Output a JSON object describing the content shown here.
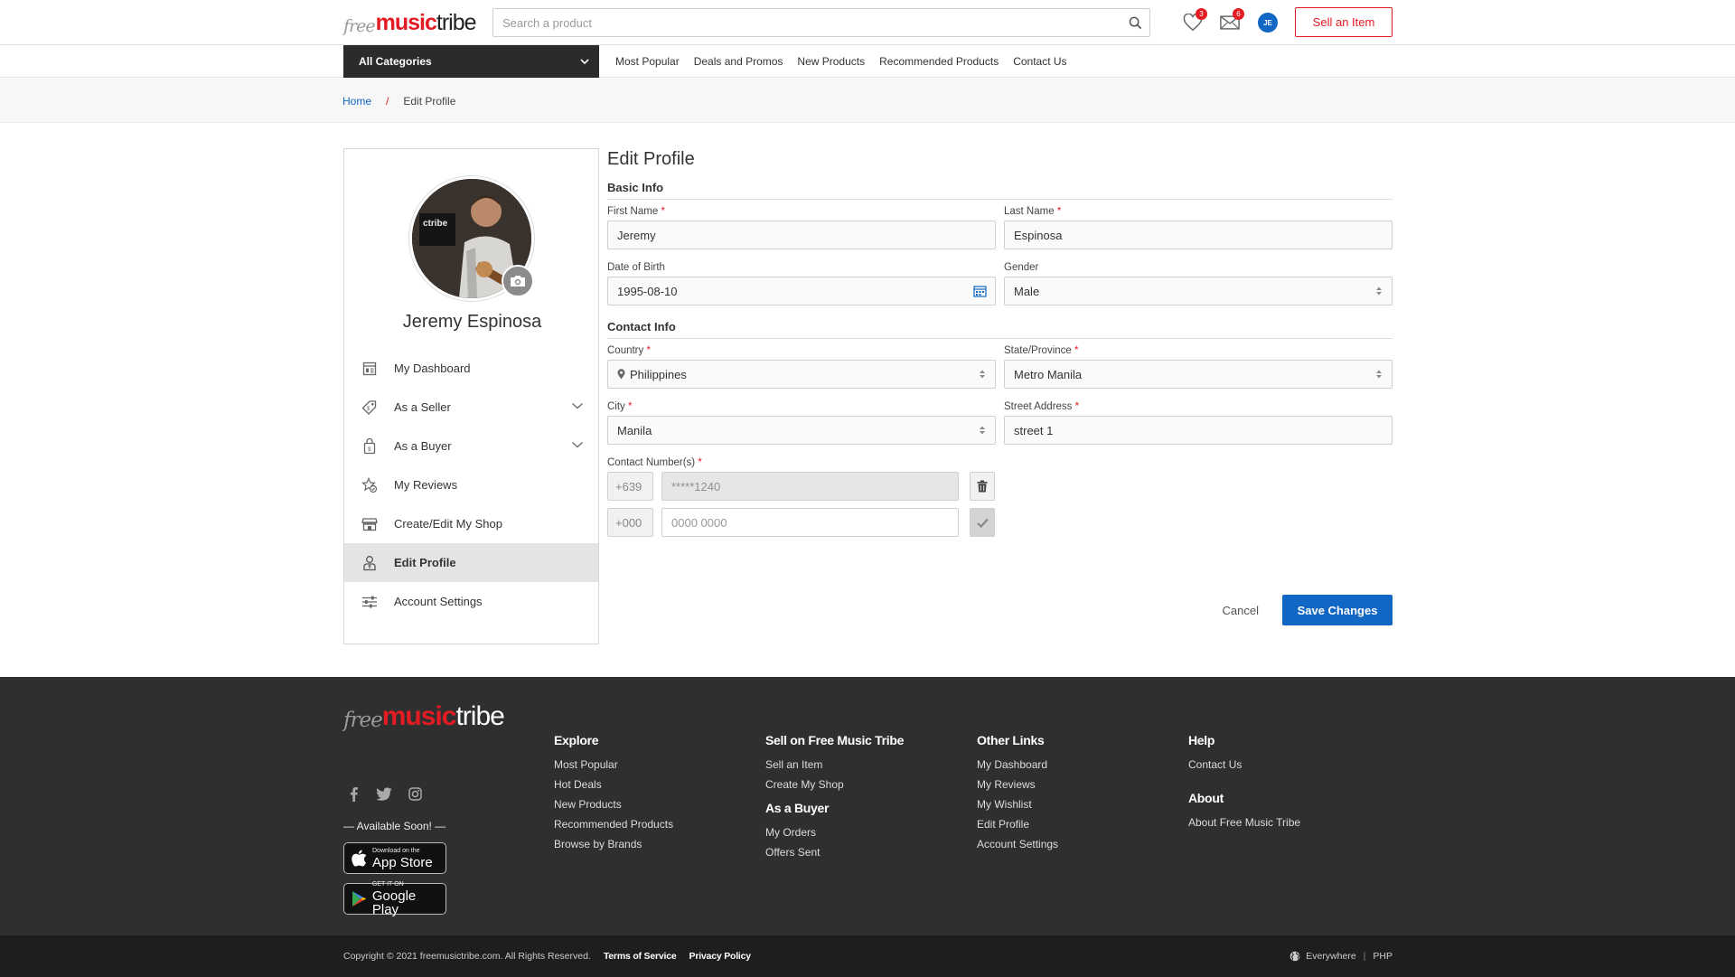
{
  "header": {
    "logo": {
      "free": "free",
      "music": "music",
      "tribe": "tribe"
    },
    "search_placeholder": "Search a product",
    "wishlist_count": "3",
    "messages_count": "6",
    "avatar_initials": "JE",
    "sell_label": "Sell an Item"
  },
  "nav": {
    "categories_label": "All Categories",
    "links": [
      "Most Popular",
      "Deals and Promos",
      "New Products",
      "Recommended Products",
      "Contact Us"
    ]
  },
  "breadcrumb": {
    "home": "Home",
    "separator": "/",
    "current": "Edit Profile"
  },
  "sidebar": {
    "name": "Jeremy Espinosa",
    "items": [
      {
        "label": "My Dashboard",
        "icon": "dashboard-icon"
      },
      {
        "label": "As a Seller",
        "icon": "tag-icon"
      },
      {
        "label": "As a Buyer",
        "icon": "bag-icon"
      },
      {
        "label": "My Reviews",
        "icon": "star-review-icon"
      },
      {
        "label": "Create/Edit My Shop",
        "icon": "store-icon"
      },
      {
        "label": "Edit Profile",
        "icon": "user-edit-icon",
        "active": true
      },
      {
        "label": "Account Settings",
        "icon": "sliders-icon"
      }
    ]
  },
  "form": {
    "title": "Edit Profile",
    "basic_info": "Basic Info",
    "contact_info": "Contact Info",
    "first_name_label": "First Name",
    "first_name": "Jeremy",
    "last_name_label": "Last Name",
    "last_name": "Espinosa",
    "dob_label": "Date of Birth",
    "dob": "1995-08-10",
    "gender_label": "Gender",
    "gender": "Male",
    "country_label": "Country",
    "country": "Philippines",
    "state_label": "State/Province",
    "state": "Metro Manila",
    "city_label": "City",
    "city": "Manila",
    "street_label": "Street Address",
    "street": "street 1",
    "contact_label": "Contact Number(s)",
    "required_mark": "*",
    "phones": [
      {
        "prefix": "+639",
        "number": "*****1240"
      },
      {
        "prefix": "+000",
        "placeholder": "0000 0000"
      }
    ],
    "cancel_label": "Cancel",
    "save_label": "Save Changes"
  },
  "footer": {
    "available": "— Available Soon! —",
    "app_store_small": "Download on the",
    "app_store_big": "App Store",
    "google_small": "GET IT ON",
    "google_big": "Google Play",
    "explore_title": "Explore",
    "explore": [
      "Most Popular",
      "Hot Deals",
      "New Products",
      "Recommended Products",
      "Browse by Brands"
    ],
    "sell_title": "Sell on Free Music Tribe",
    "sell": [
      "Sell an Item",
      "Create My Shop"
    ],
    "buyer_title": "As a Buyer",
    "buyer": [
      "My Orders",
      "Offers Sent"
    ],
    "other_title": "Other Links",
    "other": [
      "My Dashboard",
      "My Reviews",
      "My Wishlist",
      "Edit Profile",
      "Account Settings"
    ],
    "help_title": "Help",
    "help": [
      "Contact Us"
    ],
    "about_title": "About",
    "about": [
      "About Free Music Tribe"
    ],
    "copyright": "Copyright © 2021 freemusictribe.com. All Rights Reserved.",
    "terms": "Terms of Service",
    "privacy": "Privacy Policy",
    "region": "Everywhere",
    "currency": "PHP"
  },
  "colors": {
    "brand_red": "#e31b23",
    "primary_blue": "#1266c4",
    "footer_bg": "#2f2f2f"
  }
}
